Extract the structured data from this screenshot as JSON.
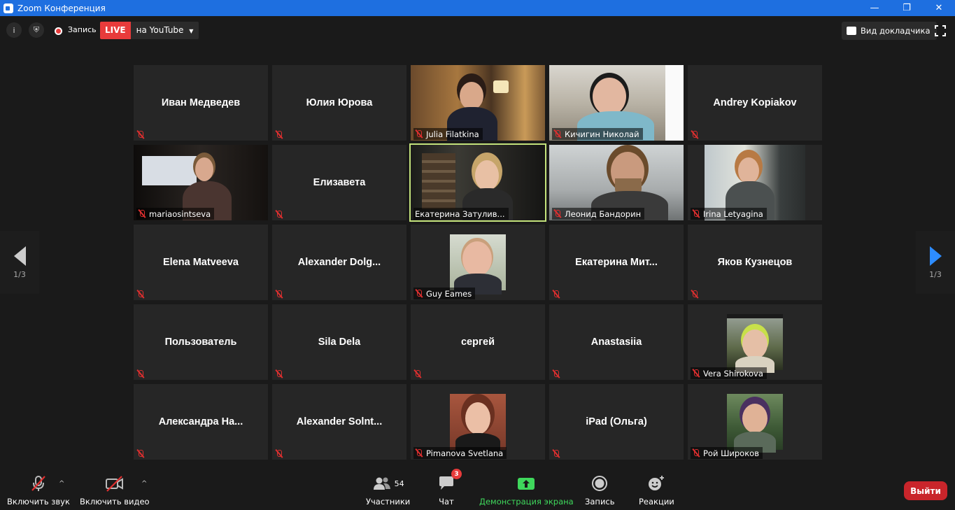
{
  "window": {
    "title": "Zoom Конференция"
  },
  "topbar": {
    "record_label": "Запись",
    "live_label": "LIVE",
    "stream_target": "на YouTube",
    "speaker_view_label": "Вид докладчика"
  },
  "pager": {
    "left_page": "1/3",
    "right_page": "1/3"
  },
  "participants": [
    {
      "name": "Иван Медведев",
      "video": false
    },
    {
      "name": "Юлия Юрова",
      "video": false
    },
    {
      "name": "Julia Filatkina",
      "video": true
    },
    {
      "name": "Кичигин Николай",
      "video": true
    },
    {
      "name": "Andrey Kopiakov",
      "video": false
    },
    {
      "name": "mariaosintseva",
      "video": true
    },
    {
      "name": "Елизавета",
      "video": false
    },
    {
      "name": "Екатерина Затулив...",
      "video": true,
      "active": true
    },
    {
      "name": "Леонид Бандорин",
      "video": true
    },
    {
      "name": "Irina Letyagina",
      "video": true
    },
    {
      "name": "Elena Matveeva",
      "video": false
    },
    {
      "name": "Alexander  Dolg...",
      "video": false
    },
    {
      "name": "Guy Eames",
      "video": true
    },
    {
      "name": "Екатерина  Мит...",
      "video": false
    },
    {
      "name": "Яков Кузнецов",
      "video": false
    },
    {
      "name": "Пользователь",
      "video": false
    },
    {
      "name": "Sila Dela",
      "video": false
    },
    {
      "name": "сергей",
      "video": false
    },
    {
      "name": "Anastasiia",
      "video": false
    },
    {
      "name": "Vera Shirokova",
      "video": true
    },
    {
      "name": "Александра  На...",
      "video": false
    },
    {
      "name": "Alexander  Solnt...",
      "video": false
    },
    {
      "name": "Pimanova Svetlana",
      "video": true
    },
    {
      "name": "iPad (Ольга)",
      "video": false
    },
    {
      "name": "Рой Широков",
      "video": true
    }
  ],
  "toolbar": {
    "audio_label": "Включить звук",
    "video_label": "Включить видео",
    "participants_label": "Участники",
    "participants_count": "54",
    "chat_label": "Чат",
    "chat_badge": "3",
    "share_label": "Демонстрация экрана",
    "record_label": "Запись",
    "reactions_label": "Реакции",
    "leave_label": "Выйти"
  },
  "colors": {
    "titlebar": "#1e6fe0",
    "live": "#e83b3b",
    "active_speaker_border": "#c3e27b",
    "share_green": "#3fd85c",
    "leave_button": "#c9252b"
  }
}
